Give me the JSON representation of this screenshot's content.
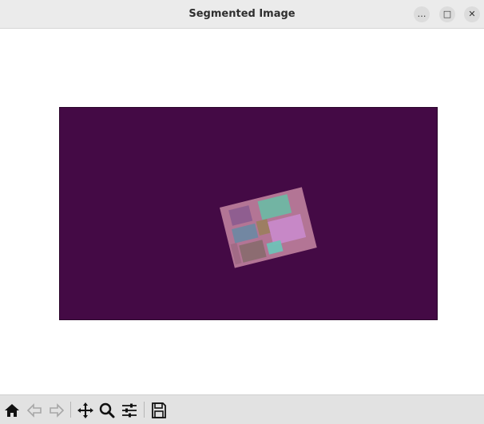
{
  "window": {
    "title": "Segmented Image",
    "controls": {
      "minimize_glyph": "…",
      "maximize_glyph": "□",
      "close_glyph": "✕"
    }
  },
  "figure": {
    "background_color": "#ffffff",
    "image_background_color": "#440a45",
    "object_colors": [
      "#b97b9a",
      "#6fb7a3",
      "#c889c9",
      "#7c9a79",
      "#8a6b6f",
      "#6a8aa3",
      "#9b5f7f"
    ]
  },
  "toolbar": {
    "buttons": [
      {
        "icon": "home-icon"
      },
      {
        "icon": "back-arrow-icon"
      },
      {
        "icon": "forward-arrow-icon"
      },
      {
        "icon": "pan-icon"
      },
      {
        "icon": "zoom-icon"
      },
      {
        "icon": "configure-subplots-icon"
      },
      {
        "icon": "save-icon"
      }
    ]
  }
}
